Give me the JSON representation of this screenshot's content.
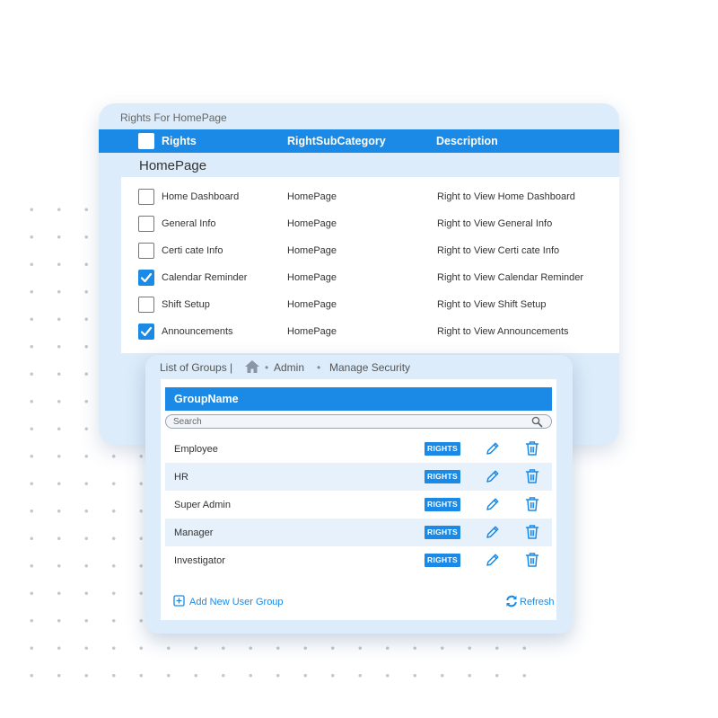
{
  "rights_panel": {
    "title": "Rights For HomePage",
    "columns": [
      "Rights",
      "RightSubCategory",
      "Description"
    ],
    "group_title": "HomePage",
    "rows": [
      {
        "name": "Home Dashboard",
        "sub": "HomePage",
        "desc": "Right to View Home Dashboard",
        "checked": false
      },
      {
        "name": "General Info",
        "sub": "HomePage",
        "desc": "Right to View General Info",
        "checked": false
      },
      {
        "name": "Certi cate Info",
        "sub": "HomePage",
        "desc": "Right to View Certi cate Info",
        "checked": false
      },
      {
        "name": "Calendar Reminder",
        "sub": "HomePage",
        "desc": "Right to View Calendar Reminder",
        "checked": true
      },
      {
        "name": "Shift Setup",
        "sub": "HomePage",
        "desc": "Right to View Shift Setup",
        "checked": false
      },
      {
        "name": "Announcements",
        "sub": "HomePage",
        "desc": "Right to View Announcements",
        "checked": true
      }
    ]
  },
  "groups_panel": {
    "list_label": "List of Groups",
    "separator": "|",
    "breadcrumb": [
      "Admin",
      "Manage Security"
    ],
    "header": "GroupName",
    "search_placeholder": "Search",
    "rights_button_label": "RIGHTS",
    "rows": [
      {
        "name": "Employee"
      },
      {
        "name": "HR"
      },
      {
        "name": "Super Admin"
      },
      {
        "name": "Manager"
      },
      {
        "name": "Investigator"
      }
    ],
    "add_label": "Add New User Group",
    "refresh_label": "Refresh"
  },
  "colors": {
    "accent": "#1a8ae6",
    "panel_bg": "#dcecfa",
    "row_alt": "#e6f1fc"
  },
  "icons": [
    "home-icon",
    "search-icon",
    "edit-icon",
    "delete-icon",
    "add-icon",
    "refresh-icon",
    "checkmark-icon"
  ]
}
